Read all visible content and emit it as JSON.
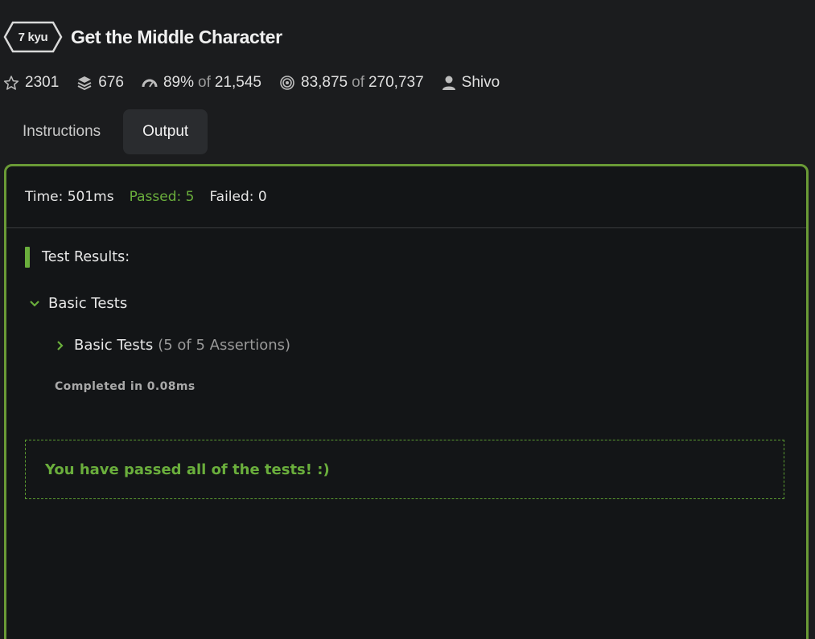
{
  "header": {
    "rank": "7 kyu",
    "title": "Get the Middle Character"
  },
  "stats": {
    "stars": "2301",
    "collections": "676",
    "satisfaction_percent": "89%",
    "satisfaction_of": "of",
    "satisfaction_votes": "21,545",
    "completed": "83,875",
    "completed_of": "of",
    "attempts": "270,737",
    "author": "Shivo"
  },
  "tabs": [
    {
      "label": "Instructions",
      "active": false
    },
    {
      "label": "Output",
      "active": true
    }
  ],
  "output": {
    "time": "Time: 501ms",
    "passed": "Passed: 5",
    "failed": "Failed: 0",
    "results_title": "Test Results:",
    "group_label": "Basic Tests",
    "subgroup_label": "Basic Tests",
    "subgroup_assertions": "(5 of 5 Assertions)",
    "completed_in": "Completed in 0.08ms",
    "success_message": "You have passed all of the tests! :)"
  },
  "colors": {
    "accent_green": "#6aae3c",
    "panel_border": "#6a9a36",
    "background": "#1b1c1e"
  },
  "icons": {
    "stars": "star-outline-icon",
    "collections": "layers-icon",
    "satisfaction": "gauge-icon",
    "completed": "target-icon",
    "author": "user-icon"
  }
}
